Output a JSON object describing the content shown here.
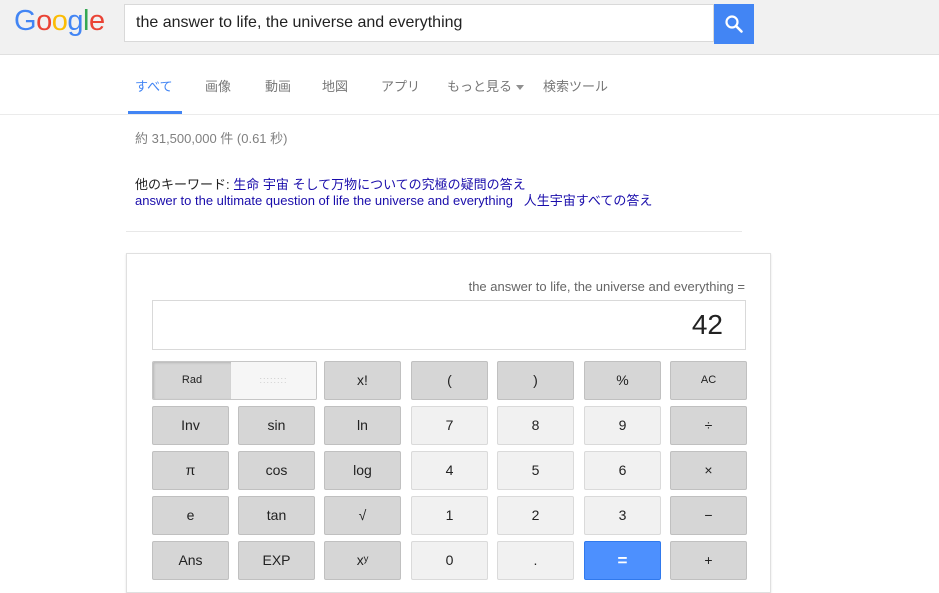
{
  "header": {
    "logo": [
      {
        "char": "G",
        "color": "#4285f4"
      },
      {
        "char": "o",
        "color": "#ea4335"
      },
      {
        "char": "o",
        "color": "#fbbc05"
      },
      {
        "char": "g",
        "color": "#4285f4"
      },
      {
        "char": "l",
        "color": "#34a853"
      },
      {
        "char": "e",
        "color": "#ea4335"
      }
    ],
    "search_value": "the answer to life, the universe and everything",
    "search_icon": "search-icon"
  },
  "tabs": {
    "all": "すべて",
    "images": "画像",
    "videos": "動画",
    "maps": "地図",
    "apps": "アプリ",
    "more": "もっと見る",
    "tools": "検索ツール"
  },
  "result_stats": "約 31,500,000 件 (0.61 秒)",
  "related": {
    "label": "他のキーワード: ",
    "link1": "生命 宇宙 そして万物についての究極の疑問の答え",
    "link2": "answer to the ultimate question of life the universe and everything",
    "link3": "人生宇宙すべての答え"
  },
  "calculator": {
    "expression": "the answer to life, the universe and everything =",
    "result": "42",
    "rad_label": "Rad",
    "deg_label": "::::::::",
    "keys": {
      "fact": "x!",
      "lparen": "(",
      "rparen": ")",
      "percent": "%",
      "ac": "AC",
      "inv": "Inv",
      "sin": "sin",
      "ln": "ln",
      "seven": "7",
      "eight": "8",
      "nine": "9",
      "divide": "÷",
      "pi": "π",
      "cos": "cos",
      "log": "log",
      "four": "4",
      "five": "5",
      "six": "6",
      "multiply": "×",
      "e": "e",
      "tan": "tan",
      "sqrt": "√",
      "one": "1",
      "two": "2",
      "three": "3",
      "minus": "−",
      "ans": "Ans",
      "exp": "EXP",
      "pow": "xʸ",
      "zero": "0",
      "dot": ".",
      "equals": "=",
      "plus": "+"
    }
  }
}
